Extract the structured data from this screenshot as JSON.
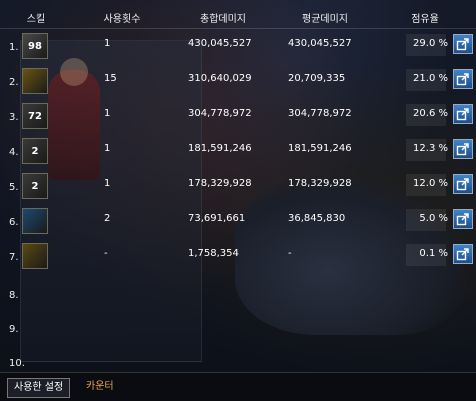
{
  "columns": {
    "skill": "스킬",
    "use_count": "사용횟수",
    "total_damage": "총합데미지",
    "avg_damage": "평균데미지",
    "share": "점유율"
  },
  "rows": [
    {
      "num": "1.",
      "icon": "skill-icon-98",
      "icon_label": "98",
      "icon_color": "#4a4a4a",
      "use_count": "1",
      "total_damage": "430,045,527",
      "avg_damage": "430,045,527",
      "share": "29.0 %"
    },
    {
      "num": "2.",
      "icon": "skill-icon-grenade",
      "icon_label": "",
      "icon_color": "#6b5412",
      "use_count": "15",
      "total_damage": "310,640,029",
      "avg_damage": "20,709,335",
      "share": "21.0 %"
    },
    {
      "num": "3.",
      "icon": "skill-icon-72",
      "icon_label": "72",
      "icon_color": "#3a3a3a",
      "use_count": "1",
      "total_damage": "304,778,972",
      "avg_damage": "304,778,972",
      "share": "20.6 %"
    },
    {
      "num": "4.",
      "icon": "skill-icon-2a",
      "icon_label": "2",
      "icon_color": "#3a3a3a",
      "use_count": "1",
      "total_damage": "181,591,246",
      "avg_damage": "181,591,246",
      "share": "12.3 %"
    },
    {
      "num": "5.",
      "icon": "skill-icon-2b",
      "icon_label": "2",
      "icon_color": "#3a3a3a",
      "use_count": "1",
      "total_damage": "178,329,928",
      "avg_damage": "178,329,928",
      "share": "12.0 %"
    },
    {
      "num": "6.",
      "icon": "skill-icon-blue",
      "icon_label": "",
      "icon_color": "#1d4a72",
      "use_count": "2",
      "total_damage": "73,691,661",
      "avg_damage": "36,845,830",
      "share": "5.0 %"
    },
    {
      "num": "7.",
      "icon": "skill-icon-spark",
      "icon_label": "",
      "icon_color": "#5a4a12",
      "use_count": "-",
      "total_damage": "1,758,354",
      "avg_damage": "-",
      "share": "0.1 %"
    },
    {
      "num": "8.",
      "icon": "",
      "icon_label": "",
      "icon_color": "",
      "use_count": "",
      "total_damage": "",
      "avg_damage": "",
      "share": ""
    },
    {
      "num": "9.",
      "icon": "",
      "icon_label": "",
      "icon_color": "",
      "use_count": "",
      "total_damage": "",
      "avg_damage": "",
      "share": ""
    },
    {
      "num": "10.",
      "icon": "",
      "icon_label": "",
      "icon_color": "",
      "use_count": "",
      "total_damage": "",
      "avg_damage": "",
      "share": ""
    }
  ],
  "share_button_icon": "share-export-icon",
  "footer": {
    "tab_active": "사용한 설정",
    "tab_other": "카운터"
  },
  "colors": {
    "accent_button": "#2b6bb0",
    "counter_tab": "#e8a74a"
  }
}
